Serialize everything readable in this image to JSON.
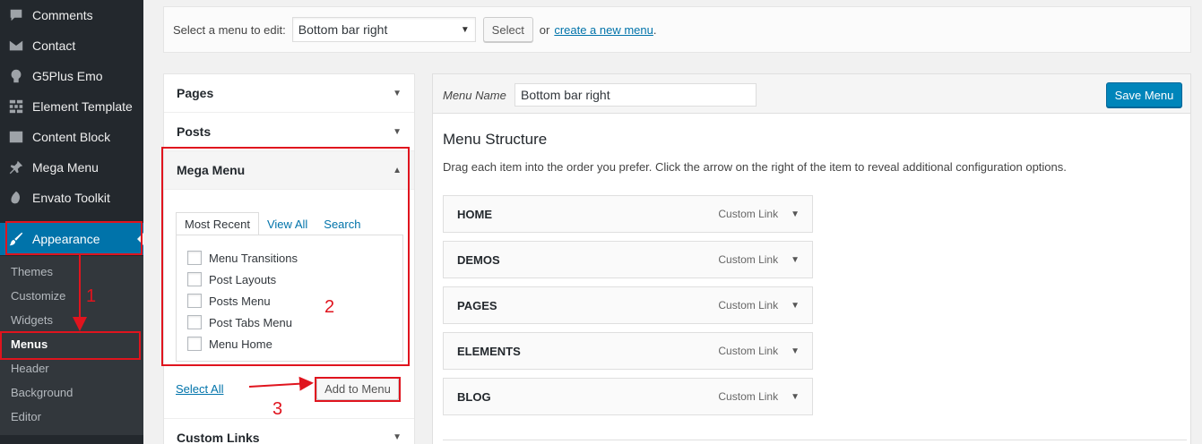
{
  "sidebar": {
    "items": [
      {
        "label": "Comments",
        "icon": "comment-icon"
      },
      {
        "label": "Contact",
        "icon": "mail-icon"
      },
      {
        "label": "G5Plus Emo",
        "icon": "lightbulb-icon"
      },
      {
        "label": "Element Template",
        "icon": "grid-icon"
      },
      {
        "label": "Content Block",
        "icon": "table-icon"
      },
      {
        "label": "Mega Menu",
        "icon": "pin-icon"
      },
      {
        "label": "Envato Toolkit",
        "icon": "leaf-icon"
      },
      {
        "label": "Appearance",
        "icon": "paintbrush-icon",
        "active": true
      }
    ],
    "submenu": [
      {
        "label": "Themes"
      },
      {
        "label": "Customize"
      },
      {
        "label": "Widgets"
      },
      {
        "label": "Menus",
        "current": true
      },
      {
        "label": "Header"
      },
      {
        "label": "Background"
      },
      {
        "label": "Editor"
      }
    ]
  },
  "select_bar": {
    "label": "Select a menu to edit:",
    "selected_menu": "Bottom bar right",
    "select_button": "Select",
    "or_text": "or",
    "create_link": "create a new menu",
    "dot": "."
  },
  "accordion": {
    "sections": [
      {
        "title": "Pages",
        "state": "collapsed"
      },
      {
        "title": "Posts",
        "state": "collapsed"
      },
      {
        "title": "Mega Menu",
        "state": "expanded"
      },
      {
        "title": "Custom Links",
        "state": "collapsed"
      }
    ],
    "tabs": [
      "Most Recent",
      "View All",
      "Search"
    ],
    "items": [
      "Menu Transitions",
      "Post Layouts",
      "Posts Menu",
      "Post Tabs Menu",
      "Menu Home"
    ],
    "select_all": "Select All",
    "add_button": "Add to Menu"
  },
  "menu_editor": {
    "name_label": "Menu Name",
    "name_value": "Bottom bar right",
    "save_button": "Save Menu",
    "structure_title": "Menu Structure",
    "structure_desc": "Drag each item into the order you prefer. Click the arrow on the right of the item to reveal additional configuration options.",
    "items": [
      {
        "title": "HOME",
        "type": "Custom Link"
      },
      {
        "title": "DEMOS",
        "type": "Custom Link"
      },
      {
        "title": "PAGES",
        "type": "Custom Link"
      },
      {
        "title": "ELEMENTS",
        "type": "Custom Link"
      },
      {
        "title": "BLOG",
        "type": "Custom Link"
      }
    ]
  },
  "annotations": {
    "step1": "1",
    "step2": "2",
    "step3": "3"
  },
  "colors": {
    "sidebar_bg": "#23282d",
    "submenu_bg": "#32373c",
    "accent": "#0073aa",
    "annotation": "#e0141e",
    "save_button": "#0085ba"
  }
}
